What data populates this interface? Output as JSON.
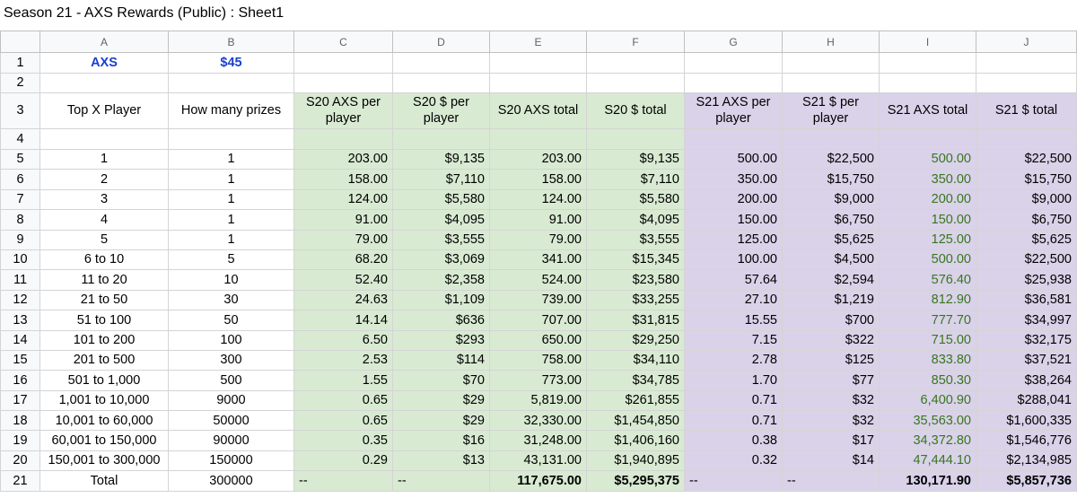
{
  "title": "Season 21 - AXS Rewards (Public) : Sheet1",
  "columns": [
    "A",
    "B",
    "C",
    "D",
    "E",
    "F",
    "G",
    "H",
    "I",
    "J"
  ],
  "row1": {
    "num": "1",
    "a": "AXS",
    "b": "$45"
  },
  "row2": {
    "num": "2"
  },
  "row3": {
    "num": "3",
    "headers": [
      "Top X Player",
      "How many prizes",
      "S20 AXS per player",
      "S20 $ per player",
      "S20 AXS total",
      "S20 $ total",
      "S21 AXS per player",
      "S21 $ per player",
      "S21 AXS total",
      "S21 $ total"
    ]
  },
  "row4": {
    "num": "4"
  },
  "rows": [
    {
      "num": "5",
      "cells": [
        "1",
        "1",
        "203.00",
        "$9,135",
        "203.00",
        "$9,135",
        "500.00",
        "$22,500",
        "500.00",
        "$22,500"
      ]
    },
    {
      "num": "6",
      "cells": [
        "2",
        "1",
        "158.00",
        "$7,110",
        "158.00",
        "$7,110",
        "350.00",
        "$15,750",
        "350.00",
        "$15,750"
      ]
    },
    {
      "num": "7",
      "cells": [
        "3",
        "1",
        "124.00",
        "$5,580",
        "124.00",
        "$5,580",
        "200.00",
        "$9,000",
        "200.00",
        "$9,000"
      ]
    },
    {
      "num": "8",
      "cells": [
        "4",
        "1",
        "91.00",
        "$4,095",
        "91.00",
        "$4,095",
        "150.00",
        "$6,750",
        "150.00",
        "$6,750"
      ]
    },
    {
      "num": "9",
      "cells": [
        "5",
        "1",
        "79.00",
        "$3,555",
        "79.00",
        "$3,555",
        "125.00",
        "$5,625",
        "125.00",
        "$5,625"
      ]
    },
    {
      "num": "10",
      "cells": [
        "6 to 10",
        "5",
        "68.20",
        "$3,069",
        "341.00",
        "$15,345",
        "100.00",
        "$4,500",
        "500.00",
        "$22,500"
      ]
    },
    {
      "num": "11",
      "cells": [
        "11 to 20",
        "10",
        "52.40",
        "$2,358",
        "524.00",
        "$23,580",
        "57.64",
        "$2,594",
        "576.40",
        "$25,938"
      ]
    },
    {
      "num": "12",
      "cells": [
        "21 to 50",
        "30",
        "24.63",
        "$1,109",
        "739.00",
        "$33,255",
        "27.10",
        "$1,219",
        "812.90",
        "$36,581"
      ]
    },
    {
      "num": "13",
      "cells": [
        "51 to 100",
        "50",
        "14.14",
        "$636",
        "707.00",
        "$31,815",
        "15.55",
        "$700",
        "777.70",
        "$34,997"
      ]
    },
    {
      "num": "14",
      "cells": [
        "101 to 200",
        "100",
        "6.50",
        "$293",
        "650.00",
        "$29,250",
        "7.15",
        "$322",
        "715.00",
        "$32,175"
      ]
    },
    {
      "num": "15",
      "cells": [
        "201 to 500",
        "300",
        "2.53",
        "$114",
        "758.00",
        "$34,110",
        "2.78",
        "$125",
        "833.80",
        "$37,521"
      ]
    },
    {
      "num": "16",
      "cells": [
        "501 to 1,000",
        "500",
        "1.55",
        "$70",
        "773.00",
        "$34,785",
        "1.70",
        "$77",
        "850.30",
        "$38,264"
      ]
    },
    {
      "num": "17",
      "cells": [
        "1,001 to 10,000",
        "9000",
        "0.65",
        "$29",
        "5,819.00",
        "$261,855",
        "0.71",
        "$32",
        "6,400.90",
        "$288,041"
      ]
    },
    {
      "num": "18",
      "cells": [
        "10,001 to 60,000",
        "50000",
        "0.65",
        "$29",
        "32,330.00",
        "$1,454,850",
        "0.71",
        "$32",
        "35,563.00",
        "$1,600,335"
      ]
    },
    {
      "num": "19",
      "cells": [
        "60,001 to 150,000",
        "90000",
        "0.35",
        "$16",
        "31,248.00",
        "$1,406,160",
        "0.38",
        "$17",
        "34,372.80",
        "$1,546,776"
      ]
    },
    {
      "num": "20",
      "cells": [
        "150,001 to 300,000",
        "150000",
        "0.29",
        "$13",
        "43,131.00",
        "$1,940,895",
        "0.32",
        "$14",
        "47,444.10",
        "$2,134,985"
      ]
    }
  ],
  "row21": {
    "num": "21",
    "cells": [
      "Total",
      "300000",
      "--",
      "--",
      "117,675.00",
      "$5,295,375",
      "--",
      "--",
      "130,171.90",
      "$5,857,736"
    ]
  }
}
